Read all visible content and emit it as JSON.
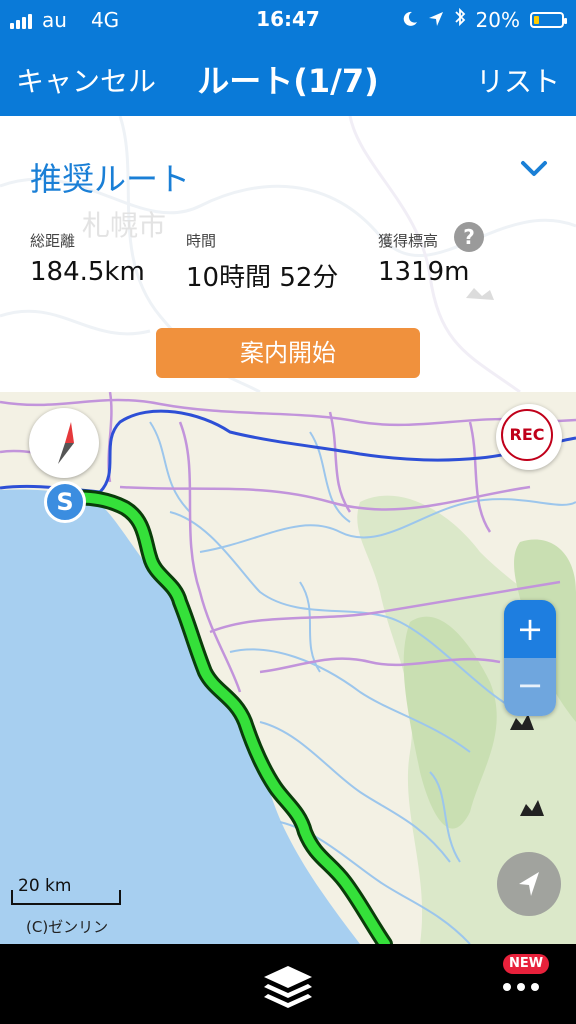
{
  "status_bar": {
    "carrier": "au",
    "network": "4G",
    "time": "16:47",
    "battery": "20%",
    "battery_level": 0.2,
    "icons": [
      "signal-icon",
      "moon-icon",
      "location-arrow-icon",
      "bluetooth-icon",
      "battery-icon"
    ]
  },
  "nav": {
    "cancel": "キャンセル",
    "title": "ルート(1/7)",
    "list": "リスト"
  },
  "route": {
    "name": "推奨ルート",
    "map_label": "札幌市",
    "distance_label": "総距離",
    "distance_value": "184.5km",
    "time_label": "時間",
    "time_value": "10時間 52分",
    "elevation_label": "獲得標高",
    "elevation_value": "1319m",
    "help": "?",
    "start_button": "案内開始"
  },
  "map": {
    "rec": "REC",
    "start_marker": "S",
    "zoom_in": "+",
    "zoom_out": "−",
    "scale": "20 km",
    "copyright": "(C)ゼンリン",
    "colors": {
      "sea": "#a7cff0",
      "land": "#f3f1e4",
      "route": "#35e03a",
      "rivers": "#9cc6ec",
      "roads": "#c294db",
      "highway": "#2d4fd6"
    }
  },
  "bottom_bar": {
    "badge": "NEW",
    "icons": [
      "layers-icon",
      "more-icon"
    ]
  }
}
